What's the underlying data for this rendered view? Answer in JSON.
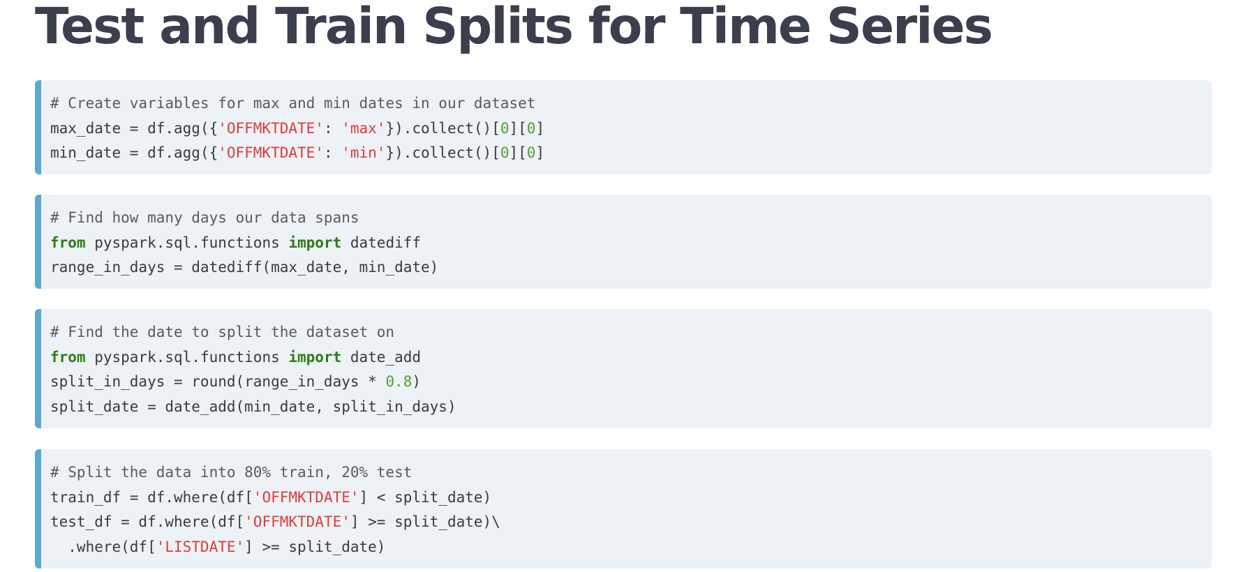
{
  "page": {
    "title": "Test and Train Splits for Time Series"
  },
  "colors": {
    "title": "#3b3f4d",
    "code_background": "#ecf2f6",
    "code_border": "#5aaad0",
    "keyword": "#2f7d12",
    "string": "#dd3c3c",
    "number": "#55a030",
    "comment": "#5a5a5a"
  },
  "code_blocks": [
    {
      "lines": [
        [
          {
            "t": "cm",
            "v": "# Create variables for max and min dates in our dataset"
          }
        ],
        [
          {
            "t": "p",
            "v": "max_date = df.agg({"
          },
          {
            "t": "st",
            "v": "'OFFMKTDATE'"
          },
          {
            "t": "p",
            "v": ": "
          },
          {
            "t": "st",
            "v": "'max'"
          },
          {
            "t": "p",
            "v": "}).collect()["
          },
          {
            "t": "nm",
            "v": "0"
          },
          {
            "t": "p",
            "v": "]["
          },
          {
            "t": "nm",
            "v": "0"
          },
          {
            "t": "p",
            "v": "]"
          }
        ],
        [
          {
            "t": "p",
            "v": "min_date = df.agg({"
          },
          {
            "t": "st",
            "v": "'OFFMKTDATE'"
          },
          {
            "t": "p",
            "v": ": "
          },
          {
            "t": "st",
            "v": "'min'"
          },
          {
            "t": "p",
            "v": "}).collect()["
          },
          {
            "t": "nm",
            "v": "0"
          },
          {
            "t": "p",
            "v": "]["
          },
          {
            "t": "nm",
            "v": "0"
          },
          {
            "t": "p",
            "v": "]"
          }
        ]
      ]
    },
    {
      "lines": [
        [
          {
            "t": "cm",
            "v": "# Find how many days our data spans"
          }
        ],
        [
          {
            "t": "kw",
            "v": "from"
          },
          {
            "t": "p",
            "v": " pyspark.sql.functions "
          },
          {
            "t": "kw",
            "v": "import"
          },
          {
            "t": "p",
            "v": " datediff"
          }
        ],
        [
          {
            "t": "p",
            "v": "range_in_days = datediff(max_date, min_date)"
          }
        ]
      ]
    },
    {
      "lines": [
        [
          {
            "t": "cm",
            "v": "# Find the date to split the dataset on"
          }
        ],
        [
          {
            "t": "kw",
            "v": "from"
          },
          {
            "t": "p",
            "v": " pyspark.sql.functions "
          },
          {
            "t": "kw",
            "v": "import"
          },
          {
            "t": "p",
            "v": " date_add"
          }
        ],
        [
          {
            "t": "p",
            "v": "split_in_days = round(range_in_days * "
          },
          {
            "t": "nm",
            "v": "0.8"
          },
          {
            "t": "p",
            "v": ")"
          }
        ],
        [
          {
            "t": "p",
            "v": "split_date = date_add(min_date, split_in_days)"
          }
        ]
      ]
    },
    {
      "lines": [
        [
          {
            "t": "cm",
            "v": "# Split the data into 80% train, 20% test"
          }
        ],
        [
          {
            "t": "p",
            "v": "train_df = df.where(df["
          },
          {
            "t": "st",
            "v": "'OFFMKTDATE'"
          },
          {
            "t": "p",
            "v": "] < split_date)"
          }
        ],
        [
          {
            "t": "p",
            "v": "test_df = df.where(df["
          },
          {
            "t": "st",
            "v": "'OFFMKTDATE'"
          },
          {
            "t": "p",
            "v": "] >= split_date)\\"
          }
        ],
        [
          {
            "t": "p",
            "v": "  .where(df["
          },
          {
            "t": "st",
            "v": "'LISTDATE'"
          },
          {
            "t": "p",
            "v": "] >= split_date)"
          }
        ]
      ]
    }
  ]
}
